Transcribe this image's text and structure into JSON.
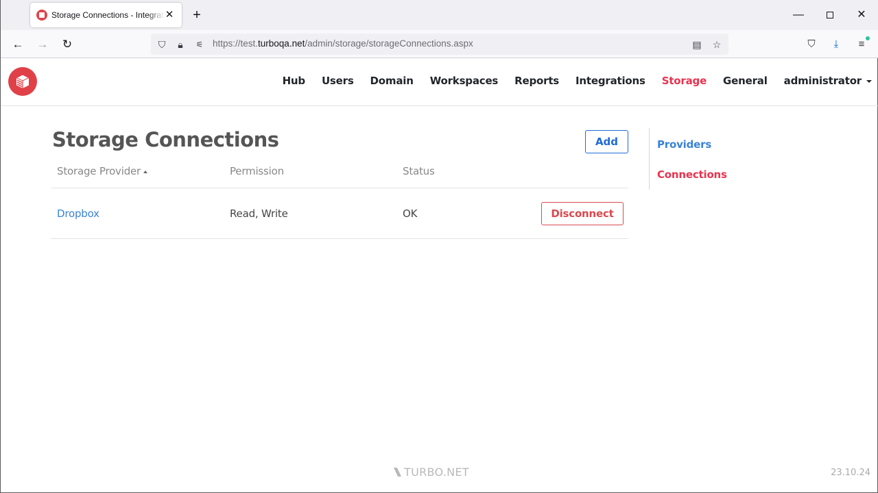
{
  "browser": {
    "tab_title": "Storage Connections - Integrations",
    "url_prefix": "https://test.",
    "url_domain": "turboqa.net",
    "url_path": "/admin/storage/storageConnections.aspx"
  },
  "header": {
    "nav": [
      {
        "label": "Hub",
        "active": false
      },
      {
        "label": "Users",
        "active": false
      },
      {
        "label": "Domain",
        "active": false
      },
      {
        "label": "Workspaces",
        "active": false
      },
      {
        "label": "Reports",
        "active": false
      },
      {
        "label": "Integrations",
        "active": false
      },
      {
        "label": "Storage",
        "active": true
      },
      {
        "label": "General",
        "active": false
      }
    ],
    "user_menu": "administrator"
  },
  "main": {
    "title": "Storage Connections",
    "add_label": "Add",
    "table": {
      "columns": [
        "Storage Provider",
        "Permission",
        "Status"
      ],
      "sorted_column": "Storage Provider",
      "sort_direction": "ascending",
      "rows": [
        {
          "provider": "Dropbox",
          "permission": "Read, Write",
          "status": "OK",
          "action": "Disconnect"
        }
      ]
    }
  },
  "side_nav": {
    "items": [
      {
        "label": "Providers",
        "active": false
      },
      {
        "label": "Connections",
        "active": true
      }
    ]
  },
  "footer": {
    "brand": "TURBO.NET",
    "version": "23.10.24"
  },
  "colors": {
    "accent_red": "#e8334f",
    "link_blue": "#3a82d6",
    "button_blue": "#1e6bd6",
    "danger": "#d9494f",
    "logo_red": "#e04048"
  }
}
